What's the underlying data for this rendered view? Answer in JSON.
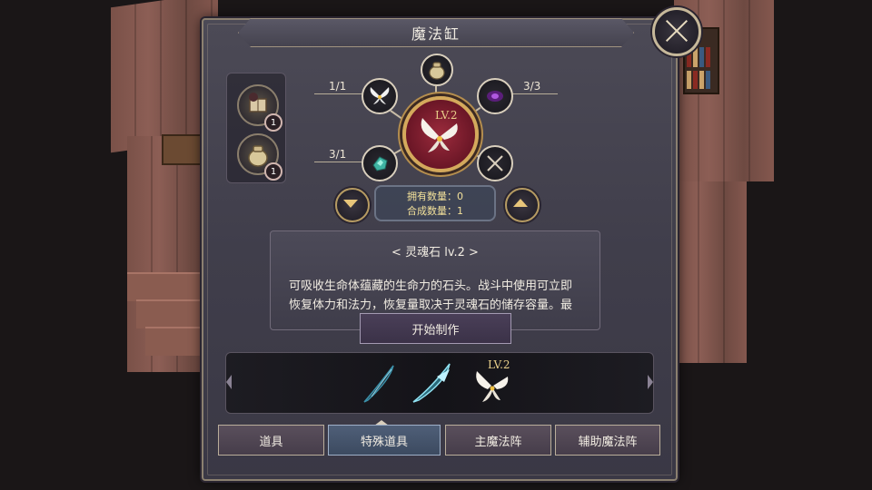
{
  "window": {
    "title": "魔法缸",
    "close_icon": "close-x-icon"
  },
  "materials": [
    {
      "icon": "scroll-book-icon",
      "count": "1"
    },
    {
      "icon": "pouch-icon",
      "count": "1"
    }
  ],
  "recipe": {
    "top_ingredient": {
      "icon": "pouch-icon"
    },
    "left_top": {
      "icon": "fairy-wings-icon",
      "count": "1/1"
    },
    "right_top": {
      "icon": "purple-eye-gem-icon",
      "count": "3/3"
    },
    "left_bottom": {
      "icon": "teal-crystal-icon",
      "count": "3/1"
    },
    "right_bottom": {
      "icon": "empty-slot-x-icon"
    },
    "result": {
      "icon": "fairy-wings-icon",
      "level": "LV.2"
    }
  },
  "info": {
    "owned": "拥有数量：0",
    "craft": "合成数量：1"
  },
  "description": {
    "title": "< 灵魂石 lv.2 >",
    "line1": "可吸收生命体蕴藏的生命力的石头。战斗中使用可立即",
    "line2": "恢复体力和法力，恢复量取决于灵魂石的储存容量。最"
  },
  "craft_button": "开始制作",
  "strip_items": [
    {
      "icon": "dark-feather-blade-icon"
    },
    {
      "icon": "teal-feather-blade-icon"
    },
    {
      "icon": "fairy-wings-icon",
      "level": "LV.2"
    }
  ],
  "tabs": [
    {
      "label": "道具",
      "active": false
    },
    {
      "label": "特殊道具",
      "active": true
    },
    {
      "label": "主魔法阵",
      "active": false
    },
    {
      "label": "辅助魔法阵",
      "active": false
    }
  ]
}
